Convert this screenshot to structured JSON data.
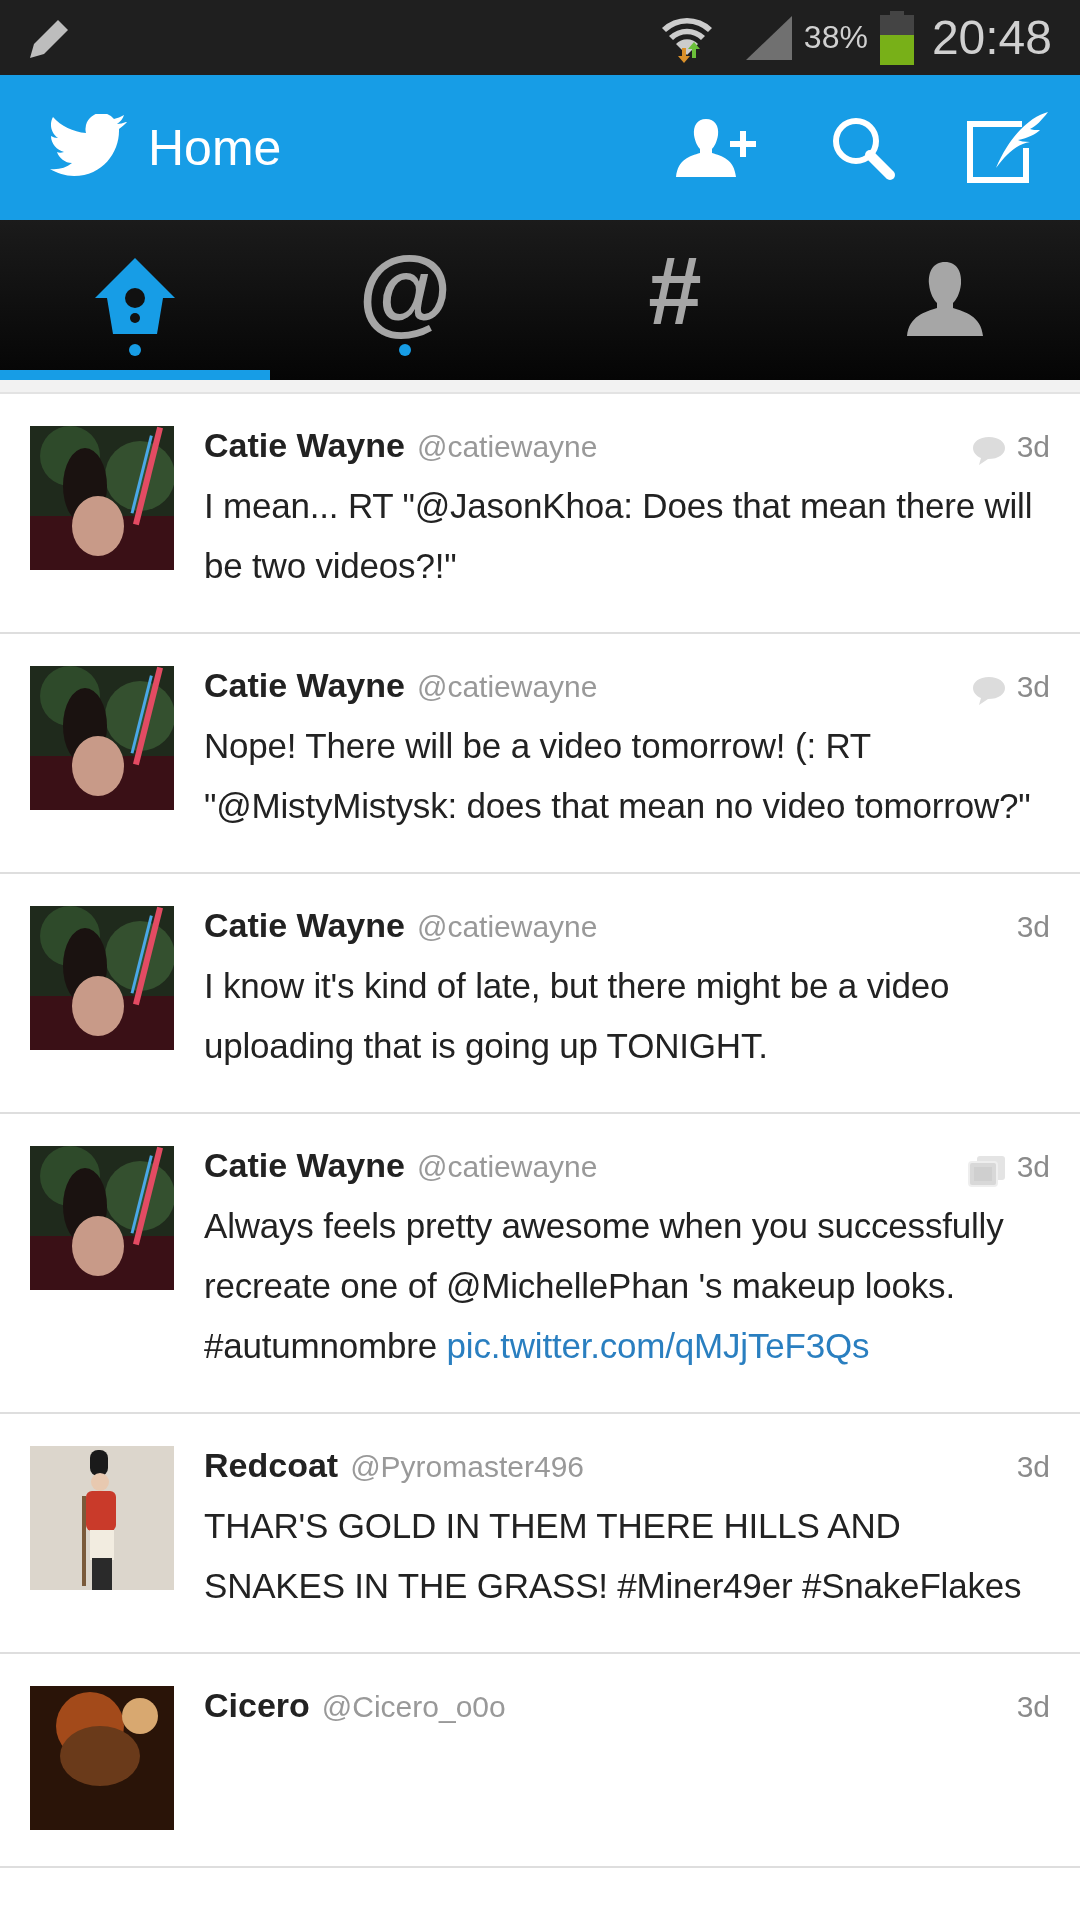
{
  "status_bar": {
    "battery": "38%",
    "time": "20:48"
  },
  "header": {
    "title": "Home"
  },
  "tabs": [
    {
      "kind": "home",
      "selected": true,
      "unread": true
    },
    {
      "kind": "glyph",
      "glyph": "@",
      "selected": false,
      "unread": true
    },
    {
      "kind": "glyph",
      "glyph": "#",
      "selected": false,
      "unread": false
    },
    {
      "kind": "profile",
      "selected": false,
      "unread": false
    }
  ],
  "tweets": [
    {
      "name": "Catie Wayne",
      "handle": "@catiewayne",
      "time": "3d",
      "kind": "conversation",
      "text": "I mean... RT \"@JasonKhoa: Does that mean there will be two videos?!\""
    },
    {
      "name": "Catie Wayne",
      "handle": "@catiewayne",
      "time": "3d",
      "kind": "conversation",
      "text": "Nope! There will be a video tomorrow!  (: RT \"@MistyMistysk: does that mean no video tomorrow?\""
    },
    {
      "name": "Catie Wayne",
      "handle": "@catiewayne",
      "time": "3d",
      "kind": "plain",
      "text": "I know it's kind of late, but there might be a video uploading that is going up TONIGHT."
    },
    {
      "name": "Catie Wayne",
      "handle": "@catiewayne",
      "time": "3d",
      "kind": "media",
      "text": "Always feels pretty awesome when you successfully recreate one of @MichellePhan 's makeup looks. #autumnombre",
      "link": "pic.twitter.com/qMJjTeF3Qs"
    },
    {
      "name": "Redcoat",
      "handle": "@Pyromaster496",
      "time": "3d",
      "kind": "plain",
      "text": "THAR'S GOLD IN THEM THERE HILLS AND SNAKES IN THE GRASS! #Miner49er #SnakeFlakes"
    },
    {
      "name": "Cicero",
      "handle": "@Cicero_o0o",
      "time": "3d",
      "kind": "plain"
    }
  ]
}
